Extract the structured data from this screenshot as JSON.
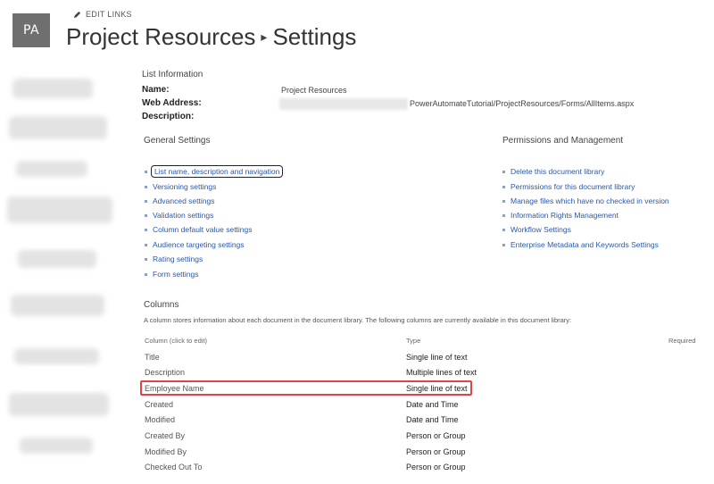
{
  "header": {
    "avatar_initials": "PA",
    "edit_links_label": "EDIT LINKS",
    "title_part1": "Project Resources",
    "separator": "▸",
    "title_part2": "Settings"
  },
  "list_info": {
    "heading": "List Information",
    "name_label": "Name:",
    "name_value": "Project Resources",
    "web_address_label": "Web Address:",
    "web_address_value": "PowerAutomateTutorial/ProjectResources/Forms/AllItems.aspx",
    "description_label": "Description:"
  },
  "general_settings": {
    "heading": "General Settings",
    "links": [
      "List name, description and navigation",
      "Versioning settings",
      "Advanced settings",
      "Validation settings",
      "Column default value settings",
      "Audience targeting settings",
      "Rating settings",
      "Form settings"
    ]
  },
  "permissions": {
    "heading": "Permissions and Management",
    "links": [
      "Delete this document library",
      "Permissions for this document library",
      "Manage files which have no checked in version",
      "Information Rights Management",
      "Workflow Settings",
      "Enterprise Metadata and Keywords Settings"
    ]
  },
  "columns": {
    "heading": "Columns",
    "description": "A column stores information about each document in the document library. The following columns are currently available in this document library:",
    "header_column": "Column (click to edit)",
    "header_type": "Type",
    "header_required": "Required",
    "rows": [
      {
        "name": "Title",
        "type": "Single line of text"
      },
      {
        "name": "Description",
        "type": "Multiple lines of text"
      },
      {
        "name": "Employee Name",
        "type": "Single line of text"
      },
      {
        "name": "Created",
        "type": "Date and Time"
      },
      {
        "name": "Modified",
        "type": "Date and Time"
      },
      {
        "name": "Created By",
        "type": "Person or Group"
      },
      {
        "name": "Modified By",
        "type": "Person or Group"
      },
      {
        "name": "Checked Out To",
        "type": "Person or Group"
      }
    ]
  },
  "colors": {
    "link": "#2a58a8",
    "highlight_border": "#e0434a",
    "avatar_bg": "#6f6f6f"
  }
}
